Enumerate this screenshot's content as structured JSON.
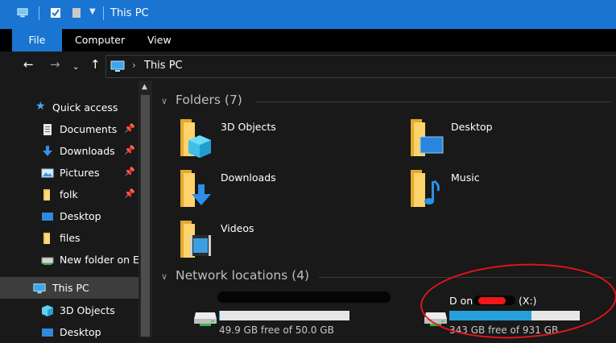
{
  "titlebar": {
    "title": "This PC"
  },
  "ribbon": {
    "tabs": [
      "File",
      "Computer",
      "View"
    ]
  },
  "address": {
    "crumb": "This PC"
  },
  "nav": {
    "items": [
      {
        "label": "Quick access",
        "icon": "star-icon",
        "pinned": false
      },
      {
        "label": "Documents",
        "icon": "documents-icon",
        "pinned": true
      },
      {
        "label": "Downloads",
        "icon": "downloads-icon",
        "pinned": true
      },
      {
        "label": "Pictures",
        "icon": "pictures-icon",
        "pinned": true
      },
      {
        "label": "folk",
        "icon": "folder-icon",
        "pinned": true
      },
      {
        "label": "Desktop",
        "icon": "desktop-icon",
        "pinned": false
      },
      {
        "label": "files",
        "icon": "folder-icon",
        "pinned": false
      },
      {
        "label": "New folder on El",
        "icon": "network-drive-icon",
        "pinned": false
      },
      {
        "label": "This PC",
        "icon": "pc-icon",
        "pinned": false,
        "selected": true
      },
      {
        "label": "3D Objects",
        "icon": "3d-objects-icon",
        "pinned": false
      },
      {
        "label": "Desktop",
        "icon": "desktop-icon",
        "pinned": false
      }
    ]
  },
  "content": {
    "folders_title": "Folders (7)",
    "folders": [
      {
        "name": "3D Objects",
        "icon": "3d-objects-folder-icon"
      },
      {
        "name": "Desktop",
        "icon": "desktop-folder-icon"
      },
      {
        "name": "Downloads",
        "icon": "downloads-folder-icon"
      },
      {
        "name": "Music",
        "icon": "music-folder-icon"
      },
      {
        "name": "Videos",
        "icon": "videos-folder-icon"
      }
    ],
    "network_title": "Network locations (4)",
    "drives": [
      {
        "name_prefix": "",
        "name_suffix": "",
        "free": "49.9 GB free of 50.0 GB",
        "used_fraction": 0.002
      },
      {
        "name_prefix": "D on",
        "name_suffix": "(X:)",
        "free": "343 GB free of 931 GB",
        "used_fraction": 0.63
      }
    ]
  },
  "colors": {
    "accent": "#1a75d2",
    "bar_fill": "#26a0da",
    "annotation": "#e0161c"
  }
}
